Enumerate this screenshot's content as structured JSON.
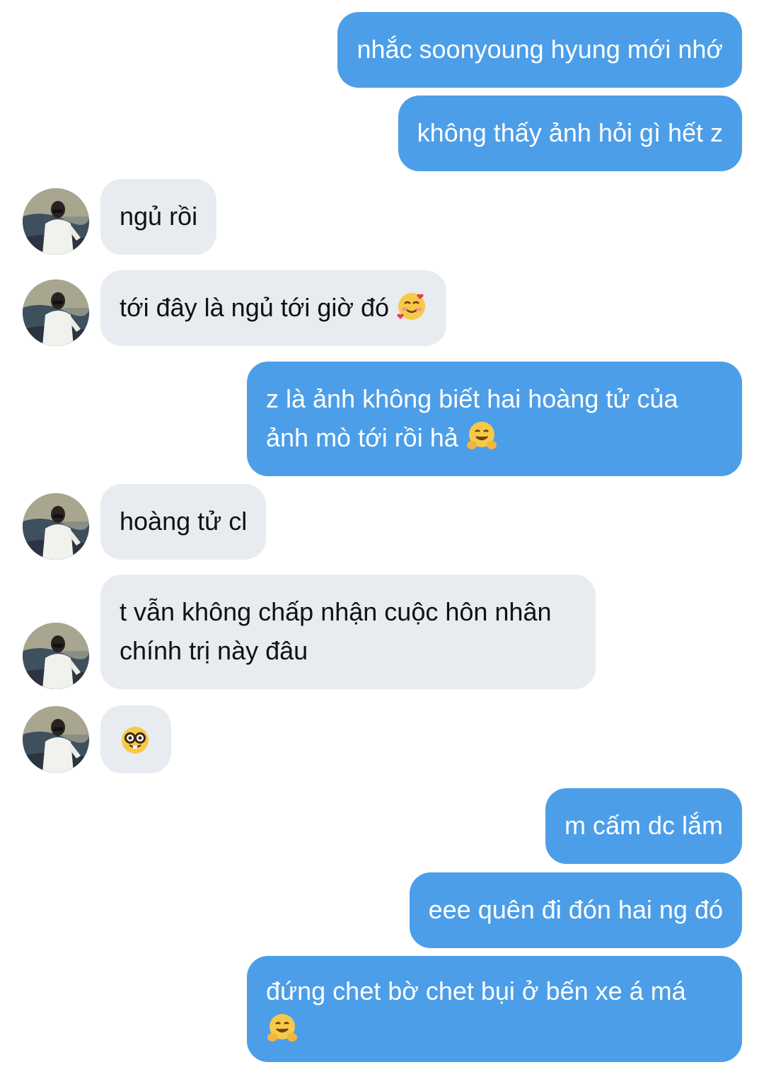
{
  "conversation": {
    "messages": [
      {
        "side": "out",
        "text": "nhắc soonyoung hyung mới nhớ"
      },
      {
        "side": "out",
        "text": "không thấy ảnh hỏi gì hết z"
      },
      {
        "side": "in",
        "text": "ngủ rồi"
      },
      {
        "side": "in",
        "text": "tới đây là ngủ tới giờ đó",
        "emoji": "smiling-face-with-hearts"
      },
      {
        "side": "out",
        "line1": "z là ảnh không biết hai hoàng tử của",
        "line2": "ảnh mò tới rồi hả",
        "emoji": "hugging-face"
      },
      {
        "side": "in",
        "text": "hoàng tử cl"
      },
      {
        "side": "in",
        "line1": "t vẫn không chấp nhận cuộc hôn nhân",
        "line2": "chính trị này đâu"
      },
      {
        "side": "in",
        "emoji": "nerd-face"
      },
      {
        "side": "out",
        "text": "m cấm dc lắm"
      },
      {
        "side": "out",
        "text": "eee quên đi đón hai ng đó"
      },
      {
        "side": "out",
        "line1": "đứng chet bờ chet bụi ở bến xe á má",
        "emoji": "hugging-face"
      }
    ]
  },
  "colors": {
    "outgoing": "#4c9ee8",
    "incoming": "#e8ecf0"
  }
}
